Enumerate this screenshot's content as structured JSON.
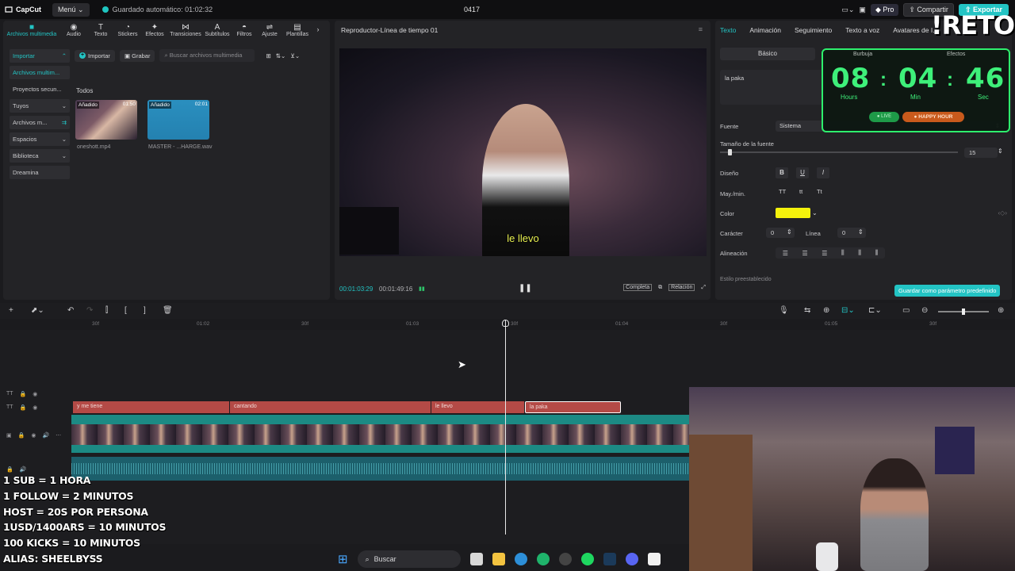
{
  "titlebar": {
    "app_name": "CapCut",
    "menu_label": "Menú",
    "autosave": "Guardado automático: 01:02:32",
    "project_name": "0417",
    "pro_label": "Pro",
    "share_label": "Compartir",
    "export_label": "Exportar"
  },
  "tool_tabs": [
    {
      "label": "Archivos multimedia",
      "icon": "media-icon"
    },
    {
      "label": "Audio",
      "icon": "audio-icon"
    },
    {
      "label": "Texto",
      "icon": "text-icon"
    },
    {
      "label": "Stickers",
      "icon": "sticker-icon"
    },
    {
      "label": "Efectos",
      "icon": "effects-icon"
    },
    {
      "label": "Transiciones",
      "icon": "transition-icon"
    },
    {
      "label": "Subtítulos",
      "icon": "captions-icon"
    },
    {
      "label": "Filtros",
      "icon": "filter-icon"
    },
    {
      "label": "Ajuste",
      "icon": "adjust-icon"
    },
    {
      "label": "Plantillas",
      "icon": "templates-icon"
    }
  ],
  "side_nav": [
    {
      "label": "Importar"
    },
    {
      "label": "Archivos multim..."
    },
    {
      "label": "Proyectos secun..."
    },
    {
      "label": "Tuyos"
    },
    {
      "label": "Archivos m..."
    },
    {
      "label": "Espacios"
    },
    {
      "label": "Biblioteca"
    },
    {
      "label": "Dreamina"
    }
  ],
  "media": {
    "import_label": "Importar",
    "record_label": "Grabar",
    "search_placeholder": "Buscar archivos multimedia",
    "all_label": "Todos",
    "items": [
      {
        "tag": "Añadido",
        "duration": "01:50",
        "name": "oneshott.mp4"
      },
      {
        "tag": "Añadido",
        "duration": "02:01",
        "name": "MASTER - ...HARGE.wav"
      }
    ]
  },
  "player": {
    "title": "Reproductor-Línea de tiempo 01",
    "subtitle": "le llevo",
    "current_time": "00:01:03:29",
    "total_time": "00:01:49:16",
    "complete_label": "Completa",
    "ratio_label": "Relación"
  },
  "props": {
    "tabs": [
      "Texto",
      "Animación",
      "Seguimiento",
      "Texto a voz",
      "Avatares de I..."
    ],
    "basic_tab": "Básico",
    "text_value": "la paka",
    "font_label": "Fuente",
    "font_value": "Sistema",
    "size_label": "Tamaño de la fuente",
    "size_value": "15",
    "design_label": "Diseño",
    "case_label": "May./min.",
    "case_options": [
      "TT",
      "tt",
      "Tt"
    ],
    "color_label": "Color",
    "color_value": "#f4f20c",
    "char_label": "Carácter",
    "char_value": "0",
    "line_label": "Línea",
    "line_value": "0",
    "align_label": "Alineación",
    "preset_label": "Estilo preestablecido",
    "save_preset": "Guardar como parámetro predefinido"
  },
  "timer": {
    "head_left": "Burbuja",
    "head_right": "Efectos",
    "hours": "08",
    "minutes": "04",
    "seconds": "46",
    "hours_label": "Hours",
    "minutes_label": "Min",
    "seconds_label": "Sec",
    "live_label": "LIVE",
    "happy_hour": "HAPPY HOUR"
  },
  "retos": "!RETOS",
  "ruler": [
    "30f",
    "01:02",
    "30f",
    "01:03",
    "30f",
    "01:04",
    "30f",
    "01:05",
    "30f"
  ],
  "subtitle_clips": [
    "y me tiene",
    "cantando",
    "le llevo",
    "la paka"
  ],
  "rules": [
    "1 SUB = 1 HORA",
    "1 FOLLOW = 2 MINUTOS",
    "HOST = 20S POR PERSONA",
    "1USD/1400ARS = 10 MINUTOS",
    "100 KICKS = 10 MINUTOS",
    "ALIAS: SHEELBYSS"
  ],
  "taskbar": {
    "search_label": "Buscar"
  }
}
